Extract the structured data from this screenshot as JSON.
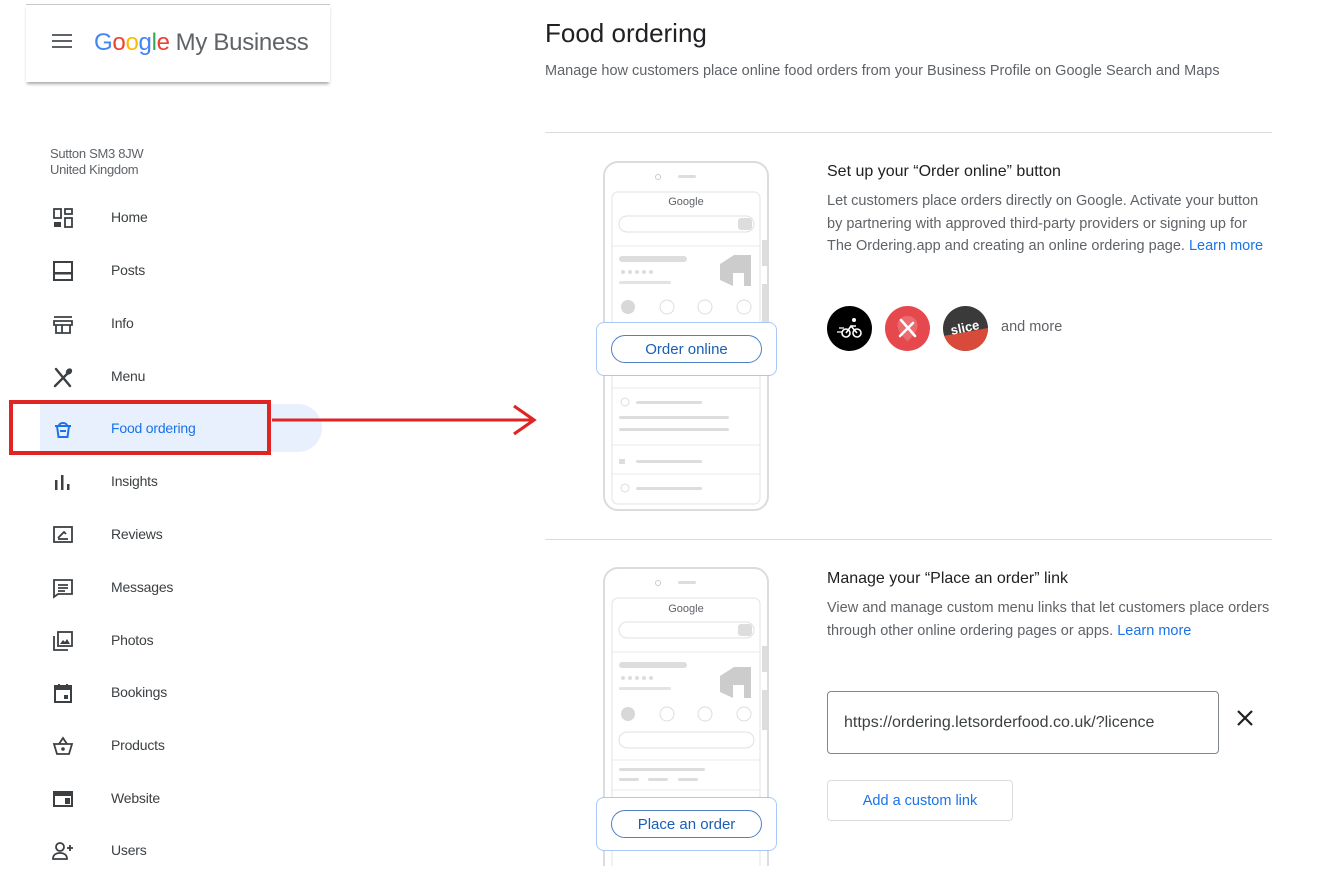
{
  "app": {
    "logo_google": [
      "G",
      "o",
      "o",
      "g",
      "l",
      "e"
    ],
    "logo_suffix": "My Business"
  },
  "location": {
    "line1": "Sutton SM3 8JW",
    "line2": "United Kingdom"
  },
  "sidebar": {
    "items": [
      {
        "label": "Home",
        "icon": "dashboard-icon"
      },
      {
        "label": "Posts",
        "icon": "posts-icon"
      },
      {
        "label": "Info",
        "icon": "storefront-icon"
      },
      {
        "label": "Menu",
        "icon": "utensils-icon"
      },
      {
        "label": "Food ordering",
        "icon": "food-ordering-icon",
        "active": true
      },
      {
        "label": "Insights",
        "icon": "insights-icon"
      },
      {
        "label": "Reviews",
        "icon": "reviews-icon"
      },
      {
        "label": "Messages",
        "icon": "messages-icon"
      },
      {
        "label": "Photos",
        "icon": "photos-icon"
      },
      {
        "label": "Bookings",
        "icon": "bookings-icon"
      },
      {
        "label": "Products",
        "icon": "products-icon"
      },
      {
        "label": "Website",
        "icon": "website-icon"
      },
      {
        "label": "Users",
        "icon": "add-user-icon"
      }
    ]
  },
  "main": {
    "title": "Food ordering",
    "subtitle": "Manage how customers place online food orders from your Business Profile on Google Search and Maps",
    "order_online": {
      "title": "Set up your “Order online” button",
      "body": "Let customers place orders directly on Google. Activate your button by partnering with approved third-party providers or signing up for The Ordering.app and creating an online ordering page.",
      "link": "Learn more",
      "providers_more": "and more",
      "illustration_button": "Order online",
      "illustration_brand": "Google"
    },
    "place_order": {
      "title": "Manage your “Place an order” link",
      "body": "View and manage custom menu links that let customers place orders through other online ordering pages or apps.",
      "link": "Learn more",
      "url_value": "https://ordering.letsorderfood.co.uk/?licence",
      "add_button": "Add a custom link",
      "illustration_button": "Place an order",
      "illustration_brand": "Google"
    }
  },
  "colors": {
    "accent": "#1a73e8",
    "highlight": "#e02424",
    "active_bg": "#e8f0fe"
  }
}
